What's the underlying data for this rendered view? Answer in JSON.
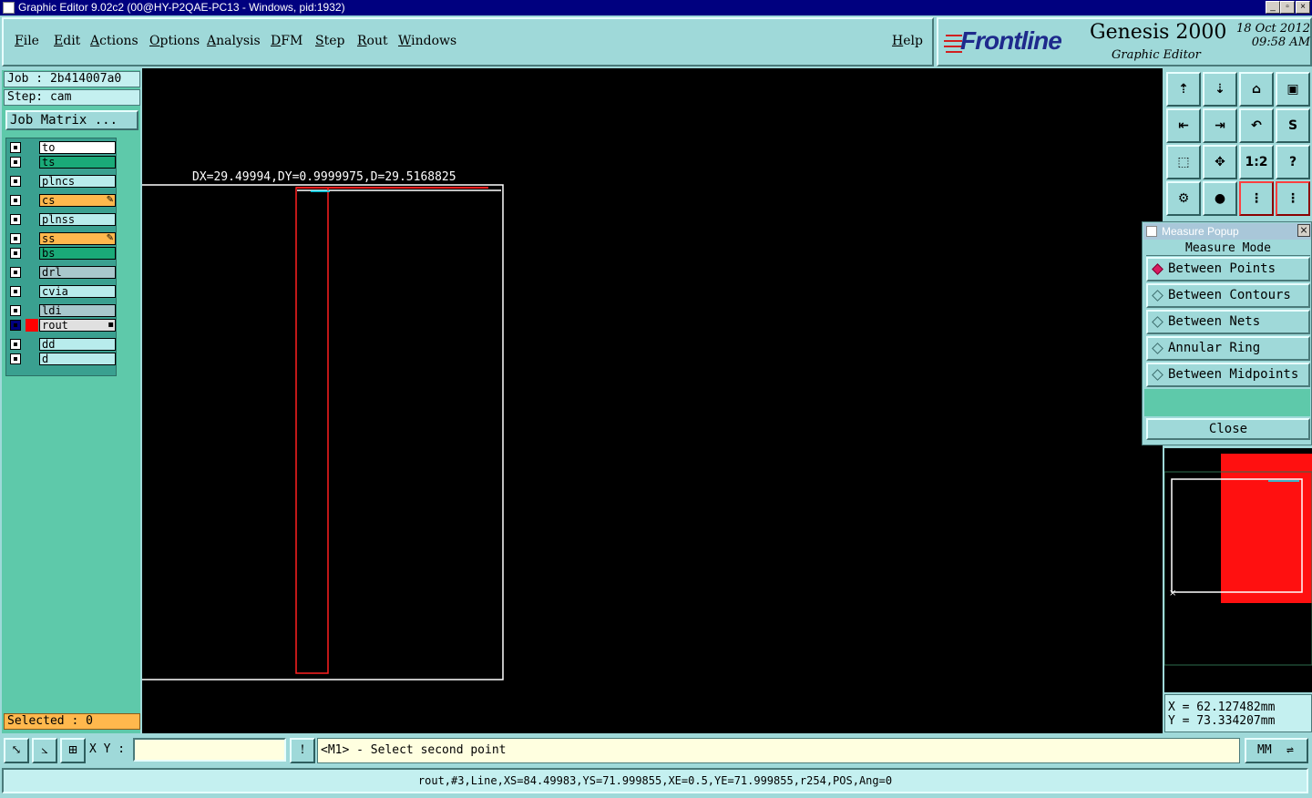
{
  "window": {
    "title": "Graphic Editor 9.02c2 (00@HY-P2QAE-PC13 - Windows, pid:1932)",
    "minimize": "_",
    "maximize": "▫",
    "close": "×"
  },
  "menu": {
    "items": [
      "File",
      "Edit",
      "Actions",
      "Options",
      "Analysis",
      "DFM",
      "Step",
      "Rout",
      "Windows"
    ],
    "help": "Help"
  },
  "logo": {
    "brand": "Frontline",
    "product": "Genesis 2000",
    "subtitle": "Graphic Editor",
    "date": "18 Oct 2012",
    "time": "09:58 AM"
  },
  "left": {
    "job": "Job : 2b414007a0",
    "step": "Step: cam",
    "job_matrix": "Job Matrix ...",
    "selected": "Selected : 0",
    "layers": [
      {
        "name": "to",
        "color": "#ffffff",
        "mark": ""
      },
      {
        "name": "ts",
        "color": "#1aaa78",
        "mark": ""
      },
      {
        "name": "plncs",
        "color": "#b8ecec",
        "mark": ""
      },
      {
        "name": "cs",
        "color": "#ffb84d",
        "mark": "✎"
      },
      {
        "name": "plnss",
        "color": "#b8ecec",
        "mark": ""
      },
      {
        "name": "ss",
        "color": "#ffb84d",
        "mark": "✎"
      },
      {
        "name": "bs",
        "color": "#1aaa78",
        "mark": ""
      },
      {
        "name": "drl",
        "color": "#a8c8cc",
        "mark": ""
      },
      {
        "name": "cvia",
        "color": "#b8ecec",
        "mark": ""
      },
      {
        "name": "ldi",
        "color": "#a8c8cc",
        "mark": ""
      },
      {
        "name": "rout",
        "color": "#e0e0e0",
        "mark": "▪"
      },
      {
        "name": "dd",
        "color": "#b8ecec",
        "mark": ""
      },
      {
        "name": "d",
        "color": "#b8ecec",
        "mark": ""
      }
    ]
  },
  "canvas": {
    "measure_text": "DX=29.49994,DY=0.9999975,D=29.5168825"
  },
  "toolbar": {
    "buttons": [
      "⇡",
      "⇣",
      "⌂",
      "▣",
      "⇤",
      "⇥",
      "↶",
      "S",
      "⬚",
      "✥",
      "1:2",
      "?",
      "⚙",
      "●",
      "⋮",
      "⋮"
    ]
  },
  "measure_popup": {
    "title": "Measure Popup",
    "mode_label": "Measure Mode",
    "options": [
      "Between Points",
      "Between Contours",
      "Between Nets",
      "Annular Ring",
      "Between Midpoints"
    ],
    "selected_index": 0,
    "close": "Close"
  },
  "coords": {
    "x": "X = 62.127482mm",
    "y": "Y = 73.334207mm"
  },
  "bottom": {
    "xy_label": "X Y :",
    "xy_value": "",
    "message": "<M1> - Select second point",
    "units": "MM",
    "status": "rout,#3,Line,XS=84.49983,YS=71.999855,XE=0.5,YE=71.999855,r254,POS,Ang=0"
  },
  "colors": {
    "panel": "#9fd9d9",
    "left_panel": "#5ec9aa",
    "canvas": "#000000",
    "rout": "#ff0000",
    "profile": "#ffffff",
    "measure_line": "#00ffff",
    "title_bar": "#00007f"
  }
}
